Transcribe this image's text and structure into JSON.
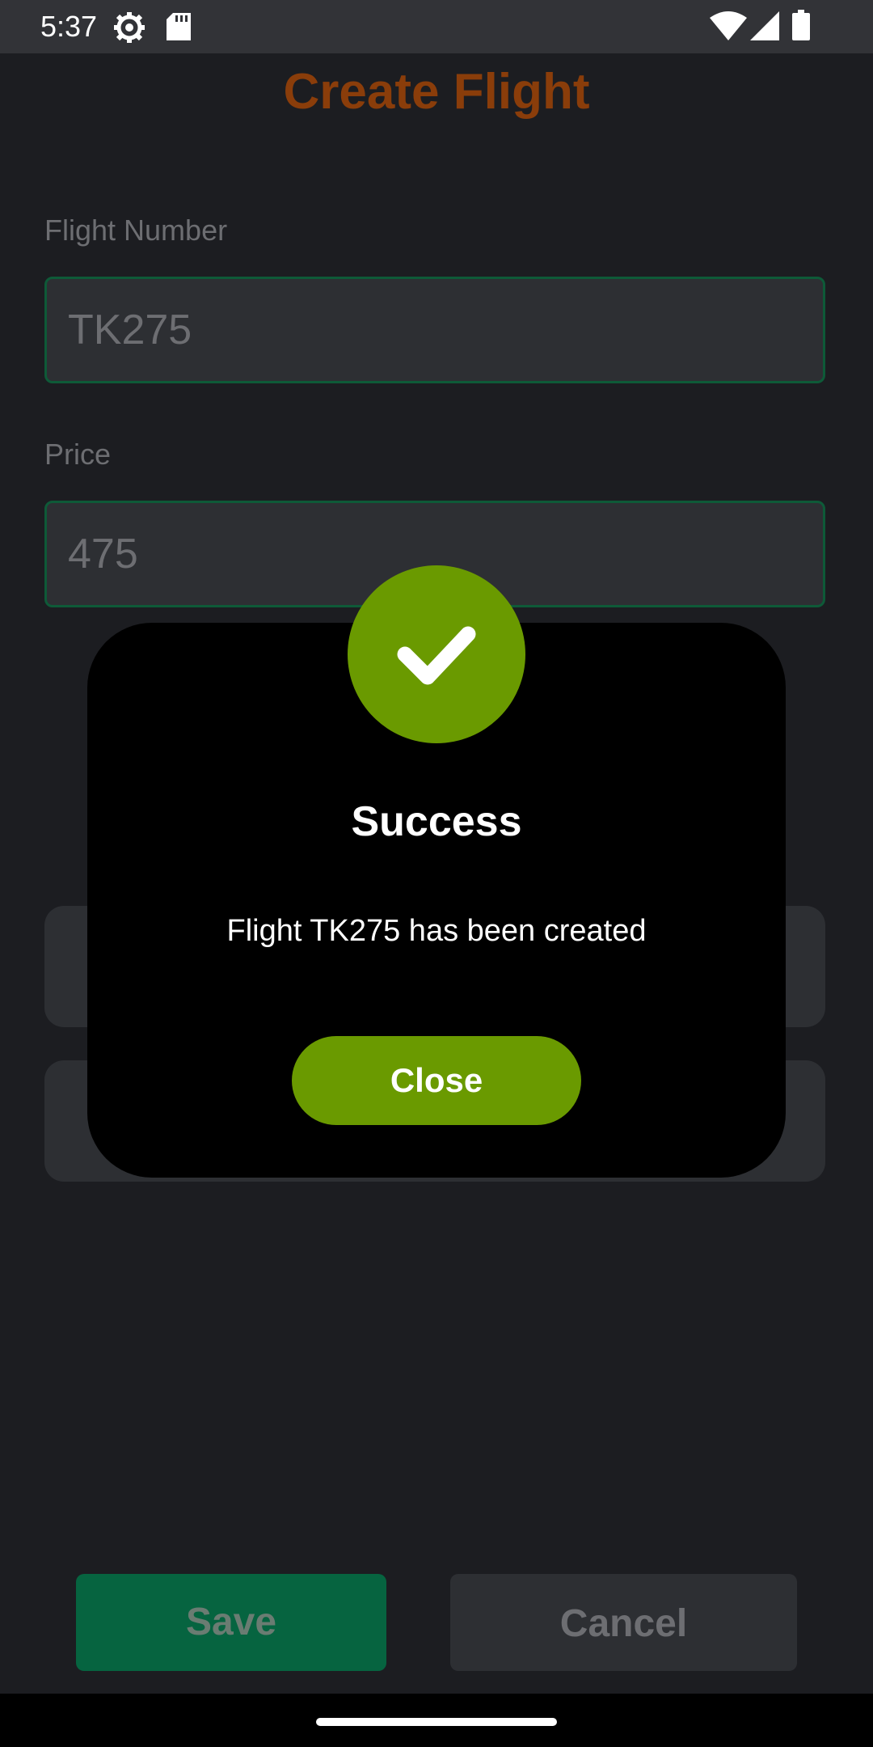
{
  "status_bar": {
    "time": "5:37",
    "icons": [
      "settings-gear-icon",
      "sd-card-icon",
      "wifi-icon",
      "cellular-signal-icon",
      "battery-icon"
    ]
  },
  "screen": {
    "title": "Create Flight",
    "fields": [
      {
        "label": "Flight Number",
        "value": "TK275"
      },
      {
        "label": "Price",
        "value": "475"
      }
    ],
    "save_label": "Save",
    "cancel_label": "Cancel"
  },
  "dialog": {
    "icon": "checkmark-icon",
    "title": "Success",
    "message": "Flight TK275 has been created",
    "close_label": "Close"
  },
  "colors": {
    "title": "#8a3d0a",
    "accent_green": "#6a9a00",
    "save_green": "#066440",
    "background": "#1c1d21"
  }
}
